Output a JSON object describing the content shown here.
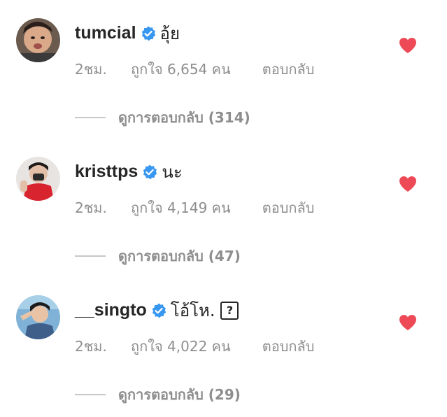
{
  "colors": {
    "username": "#262626",
    "secondary": "#8e8e8e",
    "verified": "#3897f0",
    "heart": "#ed4956",
    "rule": "#c7c7c7"
  },
  "comments": [
    {
      "username": "tumcial",
      "verified": true,
      "text": "อุ้ย",
      "time": "2ชม.",
      "likes": "ถูกใจ 6,654 คน",
      "reply": "ตอบกลับ",
      "view_replies": "ดูการตอบกลับ (314)",
      "liked": true,
      "avatar_icon": "user-avatar"
    },
    {
      "username": "kristtps",
      "verified": true,
      "text": "นะ",
      "time": "2ชม.",
      "likes": "ถูกใจ 4,149 คน",
      "reply": "ตอบกลับ",
      "view_replies": "ดูการตอบกลับ (47)",
      "liked": true,
      "avatar_icon": "user-avatar"
    },
    {
      "username": "__singto",
      "verified": true,
      "text": "โอ้โห.",
      "emoji_placeholder": "?",
      "time": "2ชม.",
      "likes": "ถูกใจ 4,022 คน",
      "reply": "ตอบกลับ",
      "view_replies": "ดูการตอบกลับ (29)",
      "liked": true,
      "avatar_icon": "user-avatar"
    }
  ]
}
